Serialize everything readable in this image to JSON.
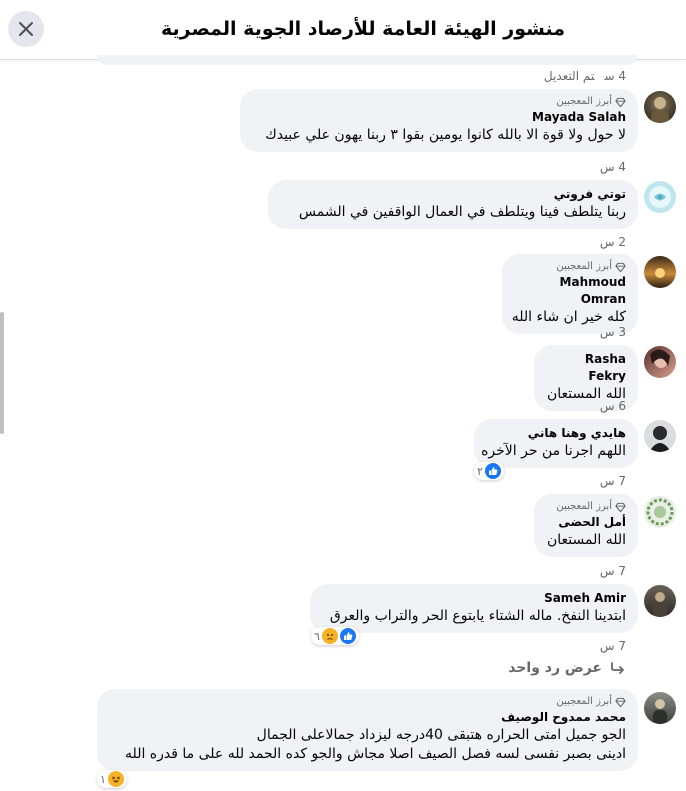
{
  "header": {
    "title": "منشور الهيئة العامة للأرصاد الجوية المصرية"
  },
  "badge_label": "أبرز المعجبين",
  "top_meta": {
    "time": "4 س",
    "edited": "تم التعديل"
  },
  "comments": [
    {
      "name": "Mayada Salah",
      "badge": true,
      "lines": [
        "لا حول ولا قوة الا بالله كانوا يومين بقوا ٣ ربنا يهون علي عبيدك"
      ],
      "time": "4 س"
    },
    {
      "name": "توتي فروتي",
      "badge": false,
      "lines": [
        "ربنا يتلطف فينا ويتلطف في العمال الواقفين في الشمس"
      ],
      "time": "2 س"
    },
    {
      "name": "Mahmoud Omran",
      "badge": true,
      "lines": [
        "كله خير ان شاء الله"
      ],
      "time": "3 س"
    },
    {
      "name": "Rasha Fekry",
      "badge": false,
      "lines": [
        "الله المستعان"
      ],
      "time": "6 س"
    },
    {
      "name": "هايدي وهنا هاني",
      "badge": false,
      "lines": [
        "اللهم اجرنا من حر الآخره"
      ],
      "time": "7 س",
      "reaction_count": "٢"
    },
    {
      "name": "أمل الحضى",
      "badge": true,
      "lines": [
        "الله المستعان"
      ],
      "time": "7 س"
    },
    {
      "name": "Sameh Amir",
      "badge": false,
      "lines": [
        "ابتدينا النفخ. ماله الشتاء يابتوع الحر والتراب والعرق"
      ],
      "time": "7 س",
      "reaction_count": "٦"
    },
    {
      "name": "محمد ممدوح الوصيف",
      "badge": true,
      "lines": [
        "الجو جميل امتى الحراره هتبقى 40درجه ليزداد جمالاعلى الجمال",
        "ادينى بصبر نفسى لسه فصل الصيف اصلا مجاش والجو كده الحمد لله على ما قدره الله"
      ],
      "reaction_count": "١"
    }
  ],
  "view_reply": {
    "label": "عرض رد واحد"
  },
  "colors": {
    "bubble": "#f0f2f5",
    "meta": "#65676b",
    "like": "#1877f2",
    "haha": "#f7b125"
  }
}
